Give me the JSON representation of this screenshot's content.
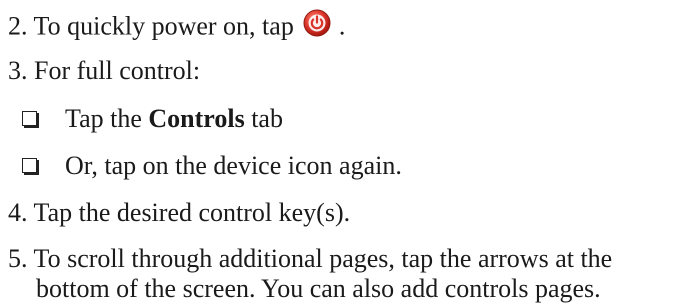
{
  "steps": {
    "step2": {
      "text_before": "2. To quickly power on, tap ",
      "text_after": " .",
      "icon": "power-button-icon",
      "icon_color": "#d9342b"
    },
    "step3": {
      "text": "3. For full control:",
      "options": [
        {
          "prefix": "Tap the ",
          "bold": "Controls",
          "suffix": " tab"
        },
        {
          "text": "Or, tap on the device icon again."
        }
      ]
    },
    "step4": {
      "text": "4. Tap the desired control key(s)."
    },
    "step5": {
      "line1": "5. To scroll through additional pages, tap the arrows at the",
      "line2": "bottom of the screen. You can also add controls pages."
    }
  }
}
